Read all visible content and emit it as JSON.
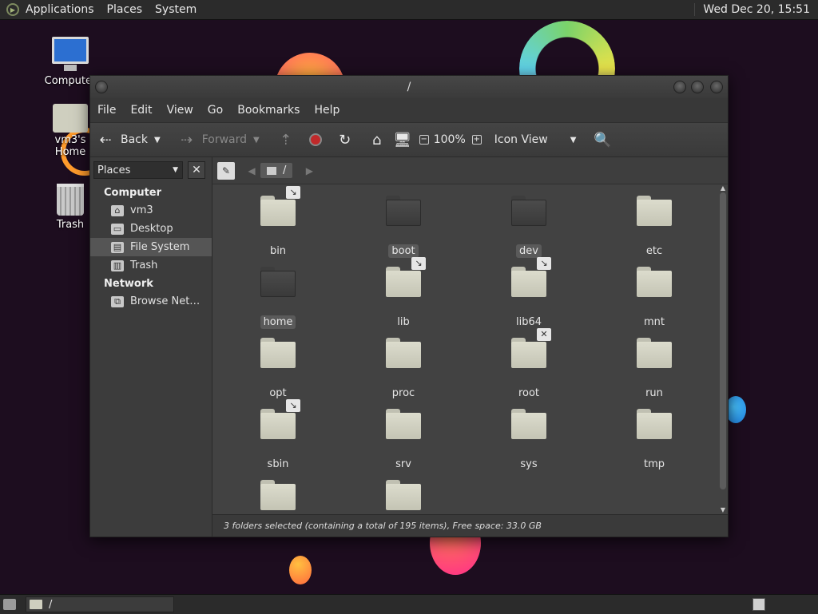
{
  "top_panel": {
    "menus": [
      "Applications",
      "Places",
      "System"
    ],
    "clock": "Wed Dec 20, 15:51"
  },
  "desktop": {
    "icons": [
      {
        "label": "Computer",
        "icon": "computer-icon"
      },
      {
        "label": "vm3's Home",
        "icon": "home-folder-icon"
      },
      {
        "label": "Trash",
        "icon": "trash-icon"
      }
    ]
  },
  "window": {
    "title": "/",
    "menubar": [
      "File",
      "Edit",
      "View",
      "Go",
      "Bookmarks",
      "Help"
    ],
    "toolbar": {
      "back_label": "Back",
      "forward_label": "Forward",
      "zoom_level": "100%",
      "view_mode": "Icon View"
    },
    "sidebar": {
      "selector_label": "Places",
      "sections": [
        {
          "heading": "Computer",
          "items": [
            {
              "label": "vm3",
              "icon": "home-icon",
              "active": false
            },
            {
              "label": "Desktop",
              "icon": "desktop-icon",
              "active": false
            },
            {
              "label": "File System",
              "icon": "drive-icon",
              "active": true
            },
            {
              "label": "Trash",
              "icon": "trash-icon",
              "active": false
            }
          ]
        },
        {
          "heading": "Network",
          "items": [
            {
              "label": "Browse Net…",
              "icon": "network-icon",
              "active": false
            }
          ]
        }
      ]
    },
    "path": {
      "crumb": "/"
    },
    "files": [
      {
        "name": "bin",
        "selected": false,
        "emblem": "link"
      },
      {
        "name": "boot",
        "selected": true,
        "emblem": ""
      },
      {
        "name": "dev",
        "selected": true,
        "emblem": ""
      },
      {
        "name": "etc",
        "selected": false,
        "emblem": ""
      },
      {
        "name": "home",
        "selected": true,
        "emblem": ""
      },
      {
        "name": "lib",
        "selected": false,
        "emblem": "link"
      },
      {
        "name": "lib64",
        "selected": false,
        "emblem": "link"
      },
      {
        "name": "mnt",
        "selected": false,
        "emblem": ""
      },
      {
        "name": "opt",
        "selected": false,
        "emblem": ""
      },
      {
        "name": "proc",
        "selected": false,
        "emblem": ""
      },
      {
        "name": "root",
        "selected": false,
        "emblem": "noaccess"
      },
      {
        "name": "run",
        "selected": false,
        "emblem": ""
      },
      {
        "name": "sbin",
        "selected": false,
        "emblem": "link"
      },
      {
        "name": "srv",
        "selected": false,
        "emblem": ""
      },
      {
        "name": "sys",
        "selected": false,
        "emblem": ""
      },
      {
        "name": "tmp",
        "selected": false,
        "emblem": ""
      },
      {
        "name": "",
        "selected": false,
        "emblem": ""
      },
      {
        "name": "",
        "selected": false,
        "emblem": ""
      }
    ],
    "status": "3 folders selected (containing a total of 195 items), Free space: 33.0 GB"
  },
  "bottom_panel": {
    "task_label": "/"
  }
}
